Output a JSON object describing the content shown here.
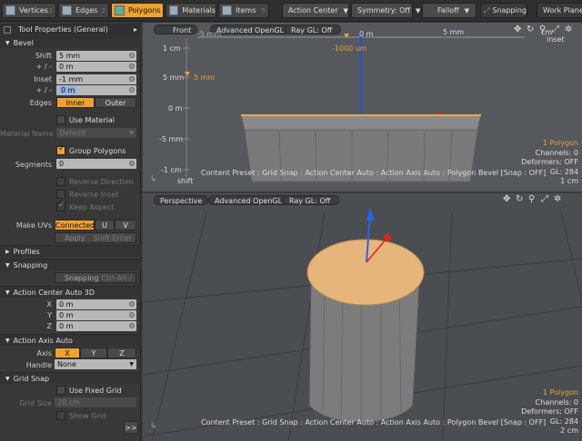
{
  "tabs": [
    {
      "label": "Vertices",
      "num": "1"
    },
    {
      "label": "Edges",
      "num": "2"
    },
    {
      "label": "Polygons",
      "num": "3"
    },
    {
      "label": "Materials",
      "num": ""
    },
    {
      "label": "Items",
      "num": "5"
    }
  ],
  "toolbar": {
    "action_center": "Action Center",
    "symmetry": "Symmetry: Off",
    "falloff": "Falloff",
    "snapping": "Snapping",
    "work_plane": "Work Plane"
  },
  "panel": {
    "title": "Tool Properties (General)",
    "bevel": {
      "header": "Bevel",
      "shift_label": "Shift",
      "shift_value": "5 mm",
      "shift_pm_label": "+ / -",
      "shift_pm_value": "0 m",
      "inset_label": "Inset",
      "inset_value": "-1 mm",
      "inset_pm_label": "+ / -",
      "inset_pm_value": "0 m",
      "edges_label": "Edges",
      "edges_inner": "Inner",
      "edges_outer": "Outer",
      "use_material": "Use Material",
      "material_name_label": "Material Name",
      "material_name_value": "Default",
      "group_polygons": "Group Polygons",
      "segments_label": "Segments",
      "segments_value": "0",
      "reverse_direction": "Reverse Direction",
      "reverse_inset": "Reverse Inset",
      "keep_aspect": "Keep Aspect",
      "make_uvs_label": "Make UVs",
      "make_uvs_connected": "Connected",
      "make_uvs_u": "U",
      "make_uvs_v": "V",
      "apply": "Apply",
      "shift_enter": "Shift-Enter"
    },
    "profiles": "Profiles",
    "snapping": {
      "header": "Snapping",
      "snapping_btn": "Snapping",
      "shortcut": "Ctrl-Alt-/"
    },
    "action_center": {
      "header": "Action Center Auto 3D",
      "x_label": "X",
      "x_value": "0 m",
      "y_label": "Y",
      "y_value": "0 m",
      "z_label": "Z",
      "z_value": "0 m"
    },
    "action_axis": {
      "header": "Action Axis Auto",
      "axis_label": "Axis",
      "axis_x": "X",
      "axis_y": "Y",
      "axis_z": "Z",
      "handle_label": "Handle",
      "handle_value": "None"
    },
    "grid_snap": {
      "header": "Grid Snap",
      "use_fixed_grid": "Use Fixed Grid",
      "grid_size_label": "Grid Size",
      "grid_size_value": "20 cm",
      "show_grid": "Show Grid"
    },
    "expand": ">>"
  },
  "top_view": {
    "view_name": "Front",
    "shading": "Advanced OpenGL",
    "ray_gl": "Ray GL: Off",
    "ruler": [
      "-5 mm",
      "0 m",
      "5 mm"
    ],
    "ruler_marker": "-1000 um",
    "y_labels": [
      "1 cm",
      "5 mm",
      "0 m",
      "-5 mm",
      "-1 cm"
    ],
    "marker_5mm": "5 mm",
    "shift_label": "shift",
    "inset_label": "inset",
    "cm_label": "cm",
    "info": {
      "polygons": "1 Polygon",
      "channels": "Channels: 0",
      "deformers": "Deformers: OFF",
      "gl": "GL: 284",
      "scale": "1 cm"
    },
    "status": "Content Preset : Grid Snap : Action Center Auto : Action Axis Auto : Polygon Bevel  [Snap : OFF]"
  },
  "bottom_view": {
    "view_name": "Perspective",
    "shading": "Advanced OpenGL",
    "ray_gl": "Ray GL: Off",
    "info": {
      "polygons": "1 Polygon",
      "channels": "Channels: 0",
      "deformers": "Deformers: OFF",
      "gl": "GL: 284",
      "scale": "2 cm"
    },
    "status": "Content Preset : Grid Snap : Action Center Auto : Action Axis Auto : Polygon Bevel  [Snap : OFF]"
  },
  "colors": {
    "accent": "#f0a030",
    "viewport": "#4a4d52",
    "panel": "#383838"
  }
}
